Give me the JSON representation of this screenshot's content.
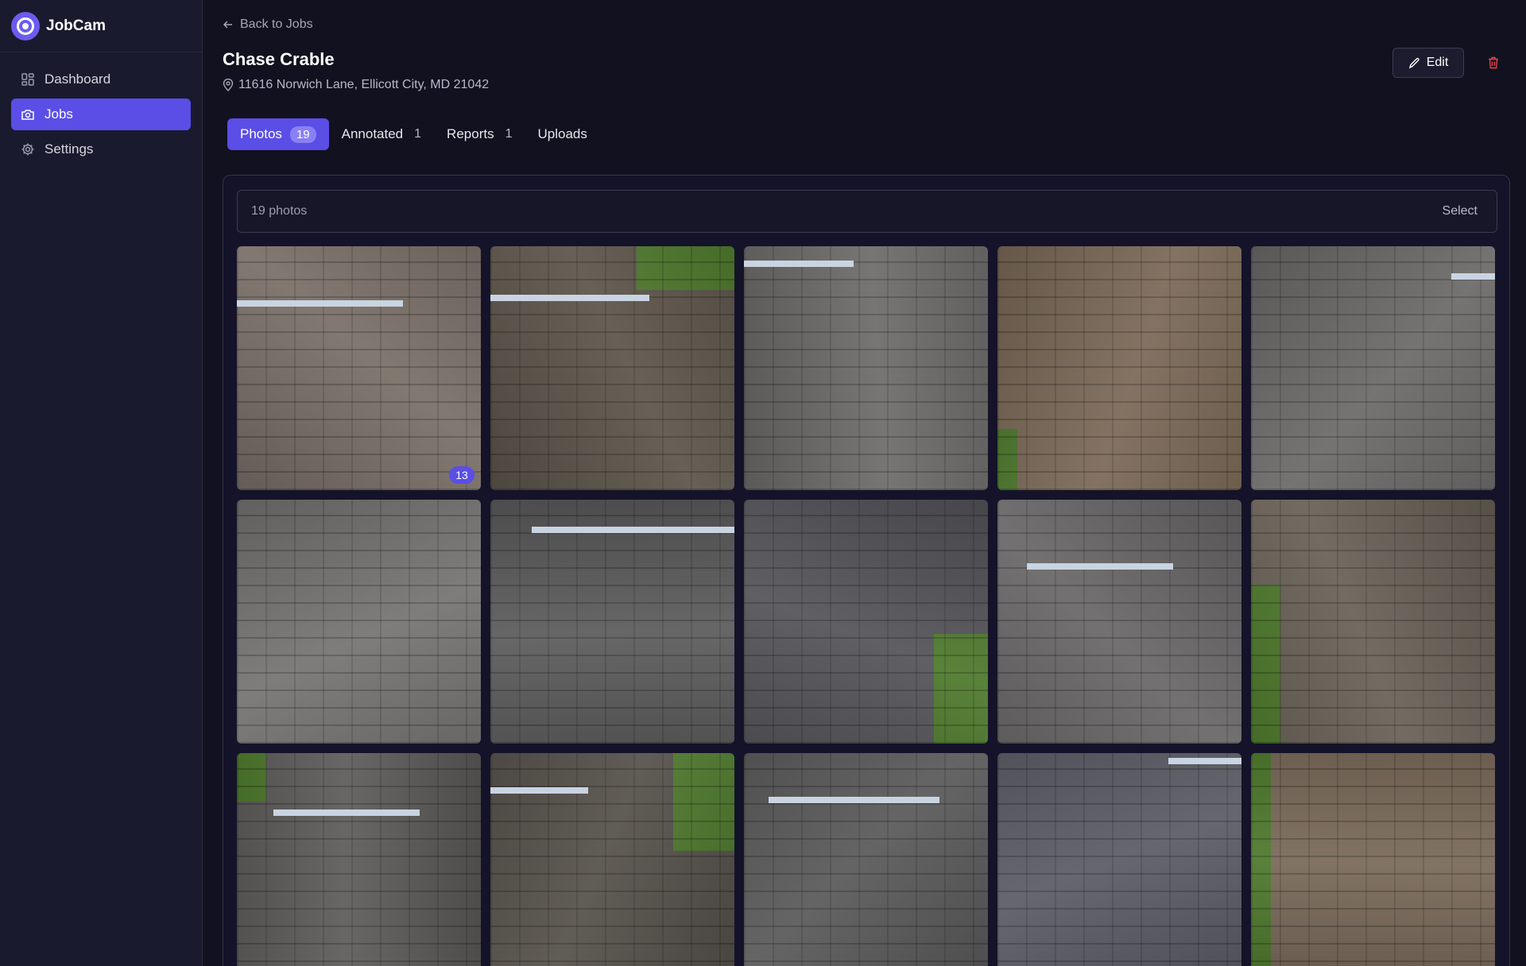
{
  "app": {
    "name": "JobCam"
  },
  "sidebar": {
    "items": [
      {
        "label": "Dashboard",
        "icon": "dashboard-icon",
        "active": false
      },
      {
        "label": "Jobs",
        "icon": "camera-icon",
        "active": true
      },
      {
        "label": "Settings",
        "icon": "gear-icon",
        "active": false
      }
    ]
  },
  "header": {
    "back_label": "Back to Jobs",
    "title": "Chase Crable",
    "address": "11616 Norwich Lane, Ellicott City, MD 21042",
    "edit_label": "Edit"
  },
  "tabs": [
    {
      "label": "Photos",
      "count": "19",
      "active": true
    },
    {
      "label": "Annotated",
      "count": "1",
      "active": false
    },
    {
      "label": "Reports",
      "count": "1",
      "active": false
    },
    {
      "label": "Uploads",
      "count": "",
      "active": false
    }
  ],
  "gallery": {
    "count_label": "19 photos",
    "select_label": "Select",
    "photos": [
      {
        "tone": "#7a7068",
        "badge": "13"
      },
      {
        "tone": "#5e564c",
        "badge": ""
      },
      {
        "tone": "#6f6d6b",
        "badge": ""
      },
      {
        "tone": "#7c6a58",
        "badge": ""
      },
      {
        "tone": "#6d6b6a",
        "badge": ""
      },
      {
        "tone": "#777573",
        "badge": ""
      },
      {
        "tone": "#5e5d5e",
        "badge": ""
      },
      {
        "tone": "#56555a",
        "badge": ""
      },
      {
        "tone": "#6a6868",
        "badge": ""
      },
      {
        "tone": "#6a6258",
        "badge": ""
      },
      {
        "tone": "#5f5d5c",
        "badge": ""
      },
      {
        "tone": "#57524c",
        "badge": ""
      },
      {
        "tone": "#5c5b5c",
        "badge": ""
      },
      {
        "tone": "#5c5d66",
        "badge": ""
      },
      {
        "tone": "#7a6a5a",
        "badge": ""
      }
    ]
  },
  "colors": {
    "accent": "#5a4ee6",
    "background": "#12111f",
    "sidebar": "#1a1a2e",
    "danger": "#e0434f"
  }
}
